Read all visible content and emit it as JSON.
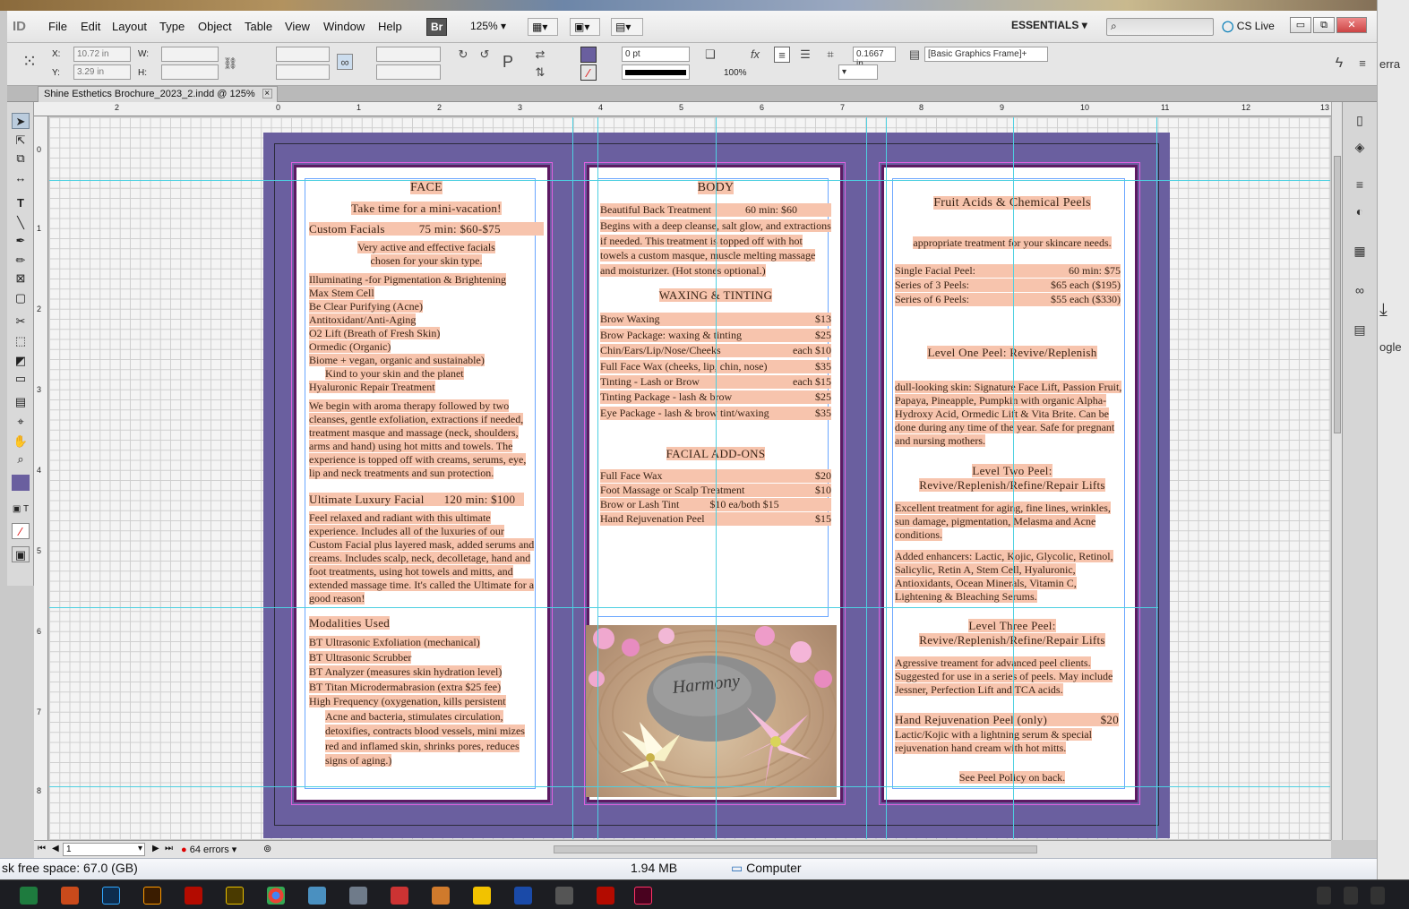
{
  "app": {
    "logo": "ID",
    "menus": [
      "File",
      "Edit",
      "Layout",
      "Type",
      "Object",
      "Table",
      "View",
      "Window",
      "Help"
    ],
    "bridge_label": "Br",
    "zoom": "125%",
    "workspace": "ESSENTIALS",
    "cs_live": "CS Live",
    "win_min": "▭",
    "win_max": "⧉",
    "win_close": "✕"
  },
  "control": {
    "x_label": "X:",
    "x_value": "10.72 in",
    "y_label": "Y:",
    "y_value": "3.29 in",
    "w_label": "W:",
    "h_label": "H:",
    "stroke_weight": "0 pt",
    "opacity": "100%",
    "corner_size": "0.1667 in",
    "object_style": "[Basic Graphics Frame]+"
  },
  "document": {
    "tab_title": "Shine Esthetics Brochure_2023_2.indd @ 125%"
  },
  "rulers": {
    "top": [
      "2",
      "0",
      "1",
      "2",
      "3",
      "4",
      "5",
      "6",
      "7",
      "8",
      "9",
      "10",
      "11",
      "12",
      "13"
    ],
    "left": [
      "0",
      "1",
      "2",
      "3",
      "4",
      "5",
      "6",
      "7",
      "8"
    ]
  },
  "brochure": {
    "face": {
      "heading": "FACE",
      "tagline": "Take time for a mini-vacation!",
      "custom_facials": {
        "name": "Custom Facials",
        "price": "75 min:  $60-$75"
      },
      "custom_desc": [
        "Very active and effective facials",
        "chosen for your skin type."
      ],
      "facial_list": [
        "Illuminating -for Pigmentation & Brightening",
        "Max Stem Cell",
        "Be Clear Purifying (Acne)",
        "Antitoxidant/Anti-Aging",
        "O2 Lift (Breath of Fresh Skin)",
        "Ormedic (Organic)",
        "Biome + vegan, organic and sustainable)",
        "Kind to your skin and the planet",
        "Hyaluronic Repair Treatment"
      ],
      "process_para": "We begin with aroma therapy followed by two cleanses, gentle exfoliation, extractions if needed, treatment masque and massage (neck, shoulders, arms and hand) using hot mitts and towels. The experience is topped off with creams, serums, eye, lip and neck treatments and sun protection.",
      "ultimate": {
        "name": "Ultimate Luxury Facial",
        "price": "120 min: $100"
      },
      "ultimate_para": "Feel relaxed and radiant with this ultimate experience. Includes all of the luxuries of our Custom Facial plus layered mask, added serums and creams. Includes scalp, neck, decolletage, hand and foot treatments, using hot towels and mitts, and extended massage time. It's called the Ultimate for a good reason!",
      "modalities_heading": "Modalities Used",
      "modalities": [
        "BT Ultrasonic Exfoliation (mechanical)",
        "BT Ultrasonic Scrubber",
        "BT Analyzer (measures skin hydration level)",
        "BT Titan Microdermabrasion (extra $25 fee)",
        "High Frequency (oxygenation, kills persistent"
      ],
      "hf_continued": "Acne and bacteria, stimulates circulation, detoxifies, contracts blood vessels, mini mizes red and inflamed skin, shrinks pores, reduces signs of aging.)"
    },
    "body": {
      "heading": "BODY",
      "back_treatment": {
        "name": "Beautiful Back Treatment",
        "price": "60 min:  $60"
      },
      "back_para": "Begins with a deep cleanse, salt glow, and extractions if needed. This treatment is topped off with hot towels a custom masque, muscle melting massage and moisturizer. (Hot stones optional.)",
      "waxing_heading": "WAXING & TINTING",
      "waxing": [
        {
          "name": "Brow Waxing",
          "price": "$13"
        },
        {
          "name": "Brow Package: waxing & tinting",
          "price": "$25"
        },
        {
          "name": "Chin/Ears/Lip/Nose/Cheeks",
          "price": "each  $10"
        },
        {
          "name": "Full Face Wax  (cheeks, lip, chin, nose)",
          "price": "$35"
        },
        {
          "name": "Tinting - Lash or Brow",
          "price": "each  $15"
        },
        {
          "name": "Tinting Package  - lash & brow",
          "price": "$25"
        },
        {
          "name": "Eye Package - lash & brow tint/waxing",
          "price": "$35"
        }
      ],
      "addons_heading": "FACIAL ADD-ONS",
      "addons": [
        {
          "name": "Full Face Wax",
          "price": "$20"
        },
        {
          "name": "Foot Massage or Scalp Treatment",
          "price": "$10"
        },
        {
          "name": "Brow or Lash Tint",
          "price": "$10 ea/both $15"
        },
        {
          "name": "Hand Rejuvenation Peel",
          "price": "$15"
        }
      ],
      "image_text": "Harmony"
    },
    "peels": {
      "heading": "Fruit Acids & Chemical Peels",
      "intro": "appropriate treatment for your skincare needs.",
      "prices": [
        {
          "name": "Single Facial Peel:",
          "price": "60 min:  $75"
        },
        {
          "name": "Series of 3 Peels:",
          "price": "$65 each ($195)"
        },
        {
          "name": "Series of 6 Peels:",
          "price": "$55 each ($330)"
        }
      ],
      "level1_heading": "Level One Peel:  Revive/Replenish",
      "level1_para": "dull-looking skin: Signature Face Lift, Passion Fruit, Papaya, Pineapple, Pumpkin with organic Alpha-Hydroxy Acid, Ormedic Lift & Vita Brite. Can be done during any time of the year. Safe for pregnant and nursing mothers.",
      "level2_heading_1": "Level Two Peel:",
      "level2_heading_2": "Revive/Replenish/Refine/Repair Lifts",
      "level2_para": "Excellent treatment for aging, fine lines, wrinkles, sun damage, pigmentation, Melasma and Acne conditions.",
      "level2_enhancers": "Added enhancers: Lactic, Kojic, Glycolic, Retinol, Salicylic, Retin A, Stem Cell, Hyaluronic, Antioxidants, Ocean Minerals, Vitamin C, Lightening & Bleaching Serums.",
      "level3_heading_1": "Level Three Peel:",
      "level3_heading_2": "Revive/Replenish/Refine/Repair Lifts",
      "level3_para": "Agressive treament for advanced peel clients. Suggested for use in a series of peels. May include Jessner, Perfection Lift and TCA acids.",
      "hand_peel": {
        "name": "Hand Rejuvenation Peel  (only)",
        "price": "$20"
      },
      "hand_para": "Lactic/Kojic with a lightning serum & special rejuvenation hand cream with hot mitts.",
      "footer": "See Peel Policy on back."
    }
  },
  "status": {
    "page": "1",
    "errors": "64 errors"
  },
  "explorer": {
    "free_space": "sk free space: 67.0 (GB)",
    "size": "1.94 MB",
    "location": "Computer"
  },
  "desktop": {
    "peek_1": "erra",
    "peek_2": "ogle"
  },
  "colors": {
    "spread_bg": "#6a5f9f",
    "highlight": "#f7c4ad",
    "guide": "#4dd0e1",
    "frame": "#5c1a63"
  }
}
